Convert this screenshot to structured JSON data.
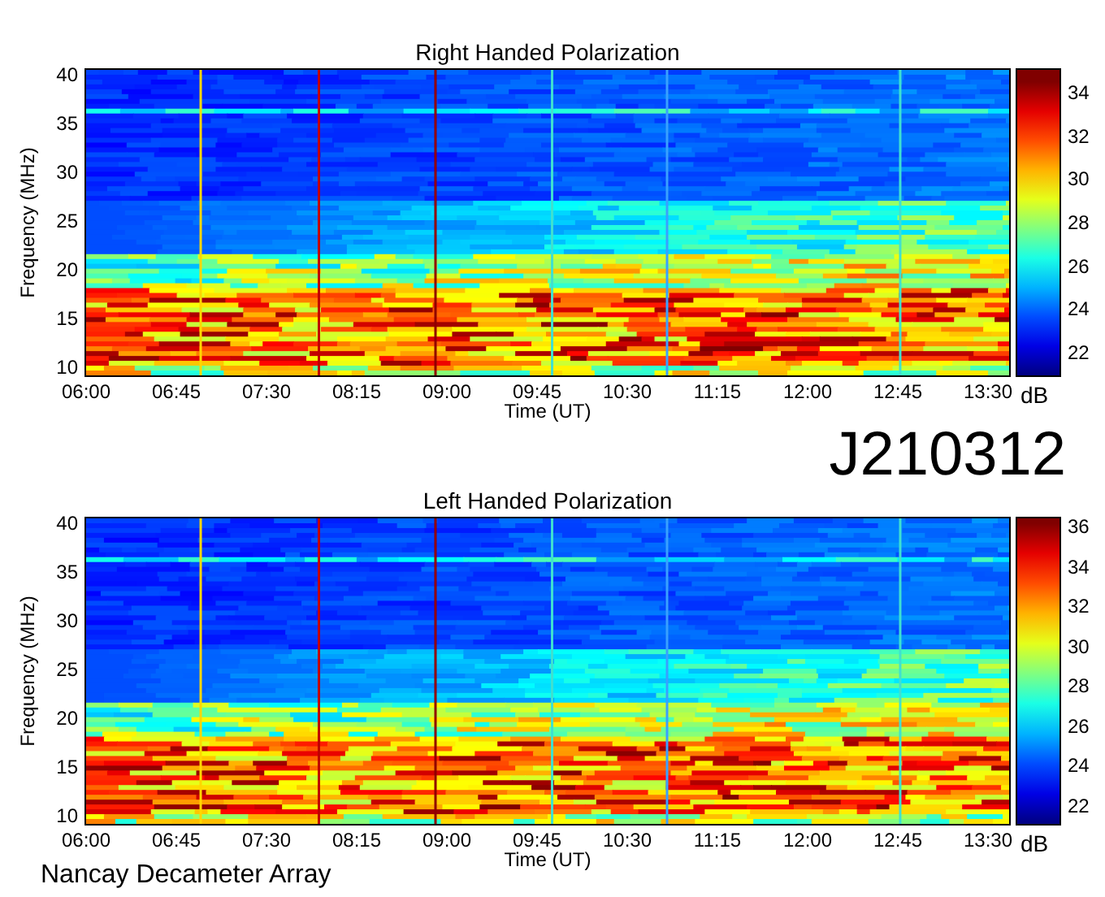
{
  "panels": [
    {
      "title": "Right Handed Polarization",
      "ylabel": "Frequency (MHz)",
      "yticks": [
        "40",
        "35",
        "30",
        "25",
        "20",
        "15",
        "10"
      ],
      "xticks": [
        "06:00",
        "06:45",
        "07:30",
        "08:15",
        "09:00",
        "09:45",
        "10:30",
        "11:15",
        "12:00",
        "12:45",
        "13:30"
      ],
      "xlabel": "Time (UT)",
      "colorbar_ticks": [
        "34",
        "32",
        "30",
        "28",
        "26",
        "24",
        "22"
      ],
      "colorbar_unit": "dB"
    },
    {
      "title": "Left Handed Polarization",
      "ylabel": "Frequency (MHz)",
      "yticks": [
        "40",
        "35",
        "30",
        "25",
        "20",
        "15",
        "10"
      ],
      "xticks": [
        "06:00",
        "06:45",
        "07:30",
        "08:15",
        "09:00",
        "09:45",
        "10:30",
        "11:15",
        "12:00",
        "12:45",
        "13:30"
      ],
      "xlabel": "Time (UT)",
      "colorbar_ticks": [
        "36",
        "34",
        "32",
        "30",
        "28",
        "26",
        "24",
        "22"
      ],
      "colorbar_unit": "dB"
    }
  ],
  "observation_id": "J210312",
  "footer": "Nancay Decameter Array"
}
